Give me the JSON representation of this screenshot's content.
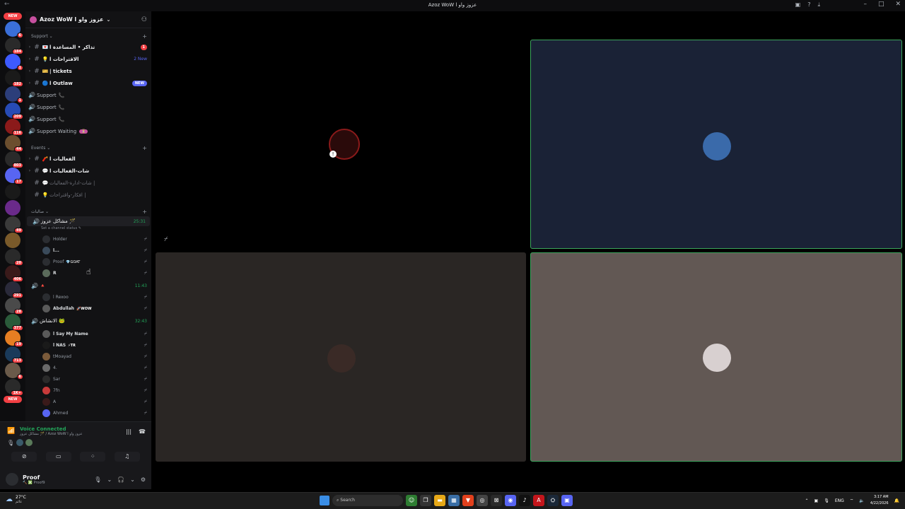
{
  "window": {
    "title": "Azoz WoW l عزوز واو",
    "back": "←",
    "icons": [
      "inbox-icon",
      "help-icon",
      "download-icon"
    ],
    "controls": [
      "–",
      "□",
      "✕"
    ]
  },
  "server_rail": {
    "new_top": "NEW",
    "new_bottom": "NEW",
    "servers": [
      {
        "color": "#3a6fd8",
        "badge": "6"
      },
      {
        "color": "#2a2a2a",
        "badge": "184"
      },
      {
        "color": "#3d5afe",
        "badge": "1"
      },
      {
        "color": "#1a1a1a",
        "badge": "182"
      },
      {
        "color": "#2c3e7a",
        "badge": "1"
      },
      {
        "color": "#274bb5",
        "badge": "209"
      },
      {
        "color": "#8b1a1a",
        "badge": "116"
      },
      {
        "color": "#6b4e2e",
        "badge": "44"
      },
      {
        "color": "#2a2a2a",
        "badge": "803"
      },
      {
        "color": "#5865f2",
        "badge": "17"
      },
      {
        "color": "#1a1a1a",
        "badge": ""
      },
      {
        "color": "#6a2a8a",
        "badge": ""
      },
      {
        "color": "#3a3a3a",
        "badge": "49"
      },
      {
        "color": "#7a5a2a",
        "badge": ""
      },
      {
        "color": "#2a2a2a",
        "badge": "20"
      },
      {
        "color": "#3a1a1a",
        "badge": "406"
      },
      {
        "color": "#2a2a3a",
        "badge": "291"
      },
      {
        "color": "#4a4a4a",
        "badge": "28"
      },
      {
        "color": "#2a5a3a",
        "badge": "377"
      },
      {
        "color": "#e67e22",
        "badge": "19"
      },
      {
        "color": "#1a3a5a",
        "badge": "713"
      },
      {
        "color": "#6a5a4a",
        "badge": "6"
      },
      {
        "color": "#2a2a2a",
        "badge": "1K+"
      }
    ]
  },
  "guild": {
    "name": "Azoz WoW l عزوز واو",
    "caret": "⌄"
  },
  "categories": {
    "support": "Support",
    "events": "Events",
    "voice": "صالبات"
  },
  "channels_support": [
    {
      "arrow": "›",
      "icon": "#",
      "emoji": "💌",
      "name": "تذاكر • المساعدة ا",
      "style": "bold",
      "badge": "1",
      "newcount": "",
      "newtag": ""
    },
    {
      "arrow": "›",
      "icon": "#",
      "emoji": "💡",
      "name": "الاقتراحات ا",
      "style": "bold",
      "badge": "",
      "newcount": "2 New",
      "newtag": ""
    },
    {
      "arrow": "›",
      "icon": "#",
      "emoji": "🎫",
      "name": "| tickets",
      "style": "bold",
      "badge": "",
      "newcount": "",
      "newtag": ""
    },
    {
      "arrow": "›",
      "icon": "#",
      "emoji": "🔵",
      "name": "l Outlaw",
      "style": "bold",
      "badge": "",
      "newcount": "",
      "newtag": "NEW"
    }
  ],
  "voice_support": [
    {
      "name": "Support",
      "phone": "📞",
      "pill": ""
    },
    {
      "name": "Support",
      "phone": "📞",
      "pill": ""
    },
    {
      "name": "Support",
      "phone": "📞",
      "pill": ""
    },
    {
      "name": "Support Waiting",
      "phone": "",
      "pill": "⏳"
    }
  ],
  "channels_events": [
    {
      "arrow": "›",
      "icon": "#",
      "emoji": "🧨",
      "name": "الفعاليات ا",
      "style": "bold"
    },
    {
      "arrow": "›",
      "icon": "#",
      "emoji": "💬",
      "name": "شات-الفعاليات ا",
      "style": "bold"
    },
    {
      "arrow": "",
      "icon": "#",
      "emoji": "💬",
      "name": "شات-ادارة-الفعاليات |",
      "style": "dim"
    },
    {
      "arrow": "",
      "icon": "#",
      "emoji": "💡",
      "name": "افكار-واقتراحات |",
      "style": "dim"
    }
  ],
  "voice1": {
    "name": "مشاكل عزوز 🪄",
    "time": "25:31",
    "status": "Set a channel status ✎",
    "members": [
      {
        "name": "Holder",
        "bright": false,
        "tag": "",
        "color": "#2b2d31"
      },
      {
        "name": "l...",
        "bright": true,
        "tag": "",
        "color": "#3a4a5a"
      },
      {
        "name": "Proof",
        "bright": false,
        "tag": "💎GOAT",
        "color": "#2b2d31"
      },
      {
        "name": "R",
        "bright": true,
        "tag": "",
        "color": "#5a6a5a"
      }
    ]
  },
  "voice2": {
    "name": "🔺",
    "time": "11:43",
    "members": [
      {
        "name": "l Rexoo",
        "bright": false,
        "tag": "",
        "color": "#2b2d31"
      },
      {
        "name": "Abdullah",
        "bright": true,
        "tag": "🚀WOW",
        "color": "#5a5a5a"
      }
    ]
  },
  "voice3": {
    "name": "الانشاش 🐸",
    "time": "32:43",
    "members": [
      {
        "name": "l Say My Name",
        "bright": true,
        "tag": "",
        "color": "#5a5a5a"
      },
      {
        "name": "l NAS",
        "bright": true,
        "tag": "⚡TR",
        "color": "#1a1a1a"
      },
      {
        "name": "tMoayad",
        "bright": false,
        "tag": "",
        "color": "#7a5a3a"
      },
      {
        "name": "4.",
        "bright": false,
        "tag": "",
        "color": "#6a6a6a"
      },
      {
        "name": "Sar",
        "bright": false,
        "tag": "",
        "color": "#2a2a2a"
      },
      {
        "name": "7fn",
        "bright": false,
        "tag": "",
        "color": "#c83a3a"
      },
      {
        "name": "A",
        "bright": false,
        "tag": "",
        "color": "#3a1a1a"
      },
      {
        "name": "Ahmed",
        "bright": false,
        "tag": "",
        "color": "#5865f2"
      }
    ]
  },
  "voice_panel": {
    "connected": "Voice Connected",
    "sub": "مشاكل عزوز 🪄 / Azoz WoW l عزوز واو"
  },
  "user": {
    "name": "Proof",
    "status": "🔨 ❎ Proof9"
  },
  "tiles": [
    {
      "bg": "#000000",
      "border": "none",
      "avatar_color": "#2a0a0a"
    },
    {
      "bg": "#1a2236",
      "border": "#3ba55c",
      "avatar_color": "#3a6aaa"
    },
    {
      "bg": "#2a2624",
      "border": "none",
      "avatar_color": "#3a2a26"
    },
    {
      "bg": "#625854",
      "border": "#3ba55c",
      "avatar_color": "#d8d0d0"
    }
  ],
  "taskbar": {
    "temp": "27°C",
    "weather_sub": "غائم",
    "search": "Search",
    "lang": "ENG",
    "time": "3:17 AM",
    "date": "4/22/2026"
  }
}
